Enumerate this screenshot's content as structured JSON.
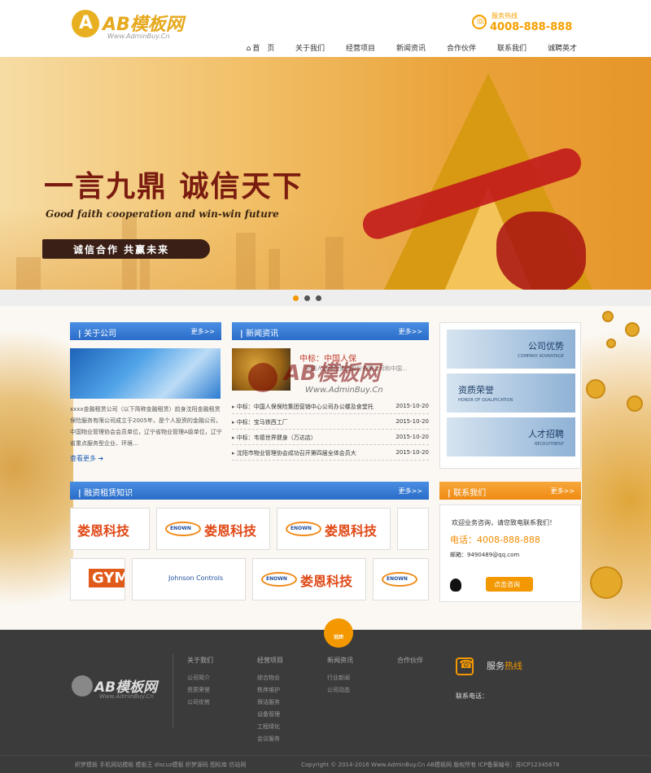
{
  "header": {
    "logo_text": "AB模板网",
    "logo_sub": "Www.AdminBuy.Cn",
    "hotline_label": "服务热线",
    "hotline_number": "4008-888-888"
  },
  "nav": {
    "items": [
      "首　页",
      "关于我们",
      "经营项目",
      "新闻资讯",
      "合作伙伴",
      "联系我们",
      "诚聘英才"
    ]
  },
  "banner": {
    "title": "一言九鼎 诚信天下",
    "subtitle": "Good faith cooperation and win-win future",
    "badge": "诚信合作 共赢未来"
  },
  "about": {
    "title": "关于公司",
    "more": "更多>>",
    "text": "xxxx金融租赁公司（以下简称金融租赁）前身沈阳金融租赁保险服务有限公司成立于2005年，是个人投资的金融公司，中国物业管理协会会员单位，辽宁省物业管理A级单位，辽宁省重点服务型企业、环境...",
    "read_more": "查看更多"
  },
  "news": {
    "title": "新闻资讯",
    "more": "更多>>",
    "top_title": "中标：中国人保",
    "top_desc": "中国人民保险集团股份有限公司和中国...",
    "rows": [
      {
        "title": "中标：中国人保保险集团营销中心公司办公楼及食堂托",
        "date": "2015-10-20"
      },
      {
        "title": "中标：宝马铁西工厂",
        "date": "2015-10-20"
      },
      {
        "title": "中标：韦德世界健身（万达店）",
        "date": "2015-10-20"
      },
      {
        "title": "沈阳市物业管理协会成功召开第四届全体会员大",
        "date": "2015-10-20"
      }
    ]
  },
  "watermark": {
    "text": "AB模板网",
    "sub": "Www.AdminBuy.Cn"
  },
  "advantages": [
    {
      "title": "公司优势",
      "sub": "COMPANY ADVANTAGE"
    },
    {
      "title": "资质荣誉",
      "sub": "HONOR OF QUALIFICATION"
    },
    {
      "title": "人才招聘",
      "sub": "RECRUITMENT"
    }
  ],
  "partners": {
    "title": "融资租赁知识",
    "more": "更多>>",
    "brand_cn": "娄恩科技",
    "brand_en": "ENOWN",
    "gym": "GYM",
    "johnson": "Johnson Controls"
  },
  "contact": {
    "title": "联系我们",
    "more": "更多>>",
    "welcome": "欢迎业务咨询，请您致电联系我们！",
    "phone": "电话：4008-888-888",
    "email": "邮箱：9490489@qq.com",
    "consult": "点击咨询"
  },
  "footer": {
    "top_btn_1": "返回",
    "top_btn_2": "TOP",
    "logo_text": "AB模板网",
    "logo_sub": "Www.AdminBuy.Cn",
    "columns": [
      {
        "title": "关于我们",
        "items": [
          "公司简介",
          "资质荣誉",
          "公司优势"
        ]
      },
      {
        "title": "经营项目",
        "items": [
          "综合物业",
          "秩序维护",
          "保洁服务",
          "设备管理",
          "工程绿化",
          "会议服务"
        ]
      },
      {
        "title": "新闻资讯",
        "items": [
          "行业新闻",
          "公司动态"
        ]
      },
      {
        "title": "合作伙伴",
        "items": []
      }
    ],
    "service_title_a": "服务",
    "service_title_b": "热线",
    "service_phone_label": "联系电话：",
    "links": "织梦模板 手机网站模板 模板王 discuz模板 织梦源码 图标库 仿站网",
    "copyright": "Copyright © 2014-2016 Www.AdminBuy.Cn AB模板网 版权所有  ICP备案编号：苏ICP12345678"
  }
}
